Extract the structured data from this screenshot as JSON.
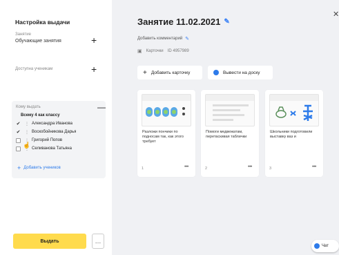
{
  "sidebar": {
    "title": "Настройка выдачи",
    "teacher_hint": "Занятие",
    "teacher_value": "Обучающие занятия",
    "access_label": "Доступна ученикам",
    "issue_header": "Кому выдать",
    "all_class": "Всему 4 как классу",
    "students": [
      {
        "name": "Александра Иванова",
        "checked": true
      },
      {
        "name": "Воскобойникова Дарья",
        "checked": true
      },
      {
        "name": "Григорий Попов",
        "checked": false
      },
      {
        "name": "Селиванова Татьяна",
        "checked": false
      }
    ],
    "add_students": "Добавить учеников",
    "issue_button": "Выдать",
    "more_button": "…"
  },
  "main": {
    "title": "Занятие 11.02.2021",
    "comment": "Добавить комментарий",
    "meta_label": "Карточки",
    "meta_id": "ID 4957989",
    "add_card": "Добавить карточку",
    "to_board": "Вывести на доску",
    "cards": [
      {
        "title": "Разложи пончики по подносам так, как этого требует",
        "num": "1"
      },
      {
        "title": "Помоги медвежатам, перетаскивая таблички",
        "num": "2"
      },
      {
        "title": "Школьники подготовили выставку ваз и",
        "num": "3"
      }
    ],
    "chat": "Чат"
  },
  "colors": {
    "accent": "#2d7bea",
    "button": "#ffdb4d"
  }
}
